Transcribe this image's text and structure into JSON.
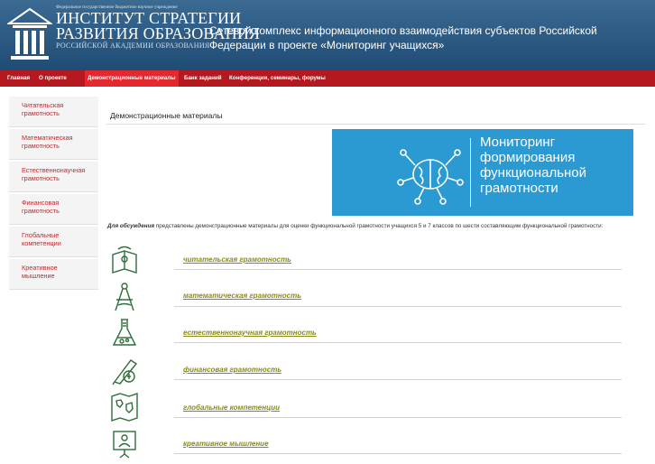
{
  "header": {
    "org_small": "Федеральное государственное бюджетное научное учреждение",
    "org_line1": "ИНСТИТУТ СТРАТЕГИИ",
    "org_line2": "РАЗВИТИЯ ОБРАЗОВАНИЯ",
    "org_sub": "РОССИЙСКОЙ АКАДЕМИИ ОБРАЗОВАНИЯ",
    "title": "Сетевой комплекс информационного взаимодействия субъектов Российской Федерации в проекте «Мониторинг учащихся»",
    "bg_color": "#2a5a82"
  },
  "nav": {
    "items": [
      "Главная",
      "О проекте",
      "Демонстрационные материалы",
      "Банк заданий",
      "Конференции, семинары, форумы"
    ],
    "active": "Демонстрационные материалы",
    "bar_color": "#b5181e"
  },
  "sidebar": {
    "items": [
      "Читательская грамотность",
      "Математическая грамотность",
      "Естественнонаучная грамотность",
      "Финансовая грамотность",
      "Глобальные компетенции",
      "Креативное мышление"
    ]
  },
  "main": {
    "title": "Демонстрационные материалы",
    "banner_lines": [
      "Мониторинг",
      "формирования",
      "функциональной",
      "грамотности"
    ],
    "intro_lead": "Для обсуждения",
    "intro_rest": " представлены демонстрационные материалы для оценки функциональной грамотности учащихся 5 и 7 классов по шести составляющим функциональной грамотности:",
    "links": [
      "читательская грамотность",
      "математическая грамотность",
      "естественнонаучная грамотность",
      "финансовая грамотность",
      "глобальные компетенции",
      "креативное мышление"
    ],
    "icons": [
      "book-icon",
      "compass-icon",
      "flask-icon",
      "pen-coin-icon",
      "globe-map-icon",
      "presentation-icon"
    ],
    "banner_color": "#2b9ad2"
  }
}
